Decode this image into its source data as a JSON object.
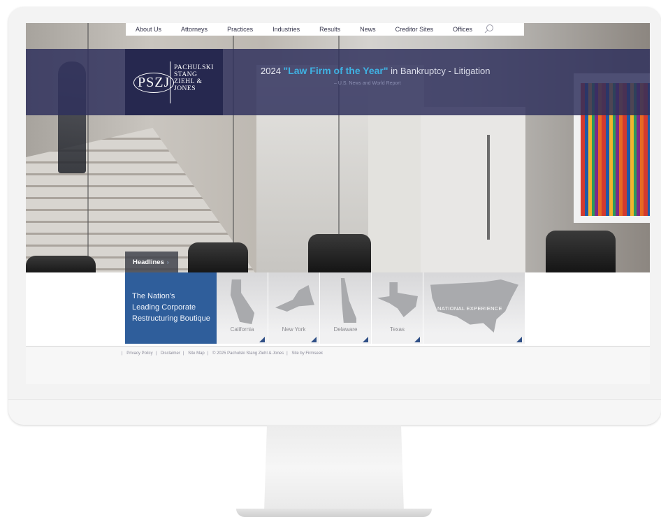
{
  "nav": {
    "items": [
      "About Us",
      "Attorneys",
      "Practices",
      "Industries",
      "Results",
      "News",
      "Creditor Sites",
      "Offices"
    ],
    "search_icon": "search-icon"
  },
  "logo": {
    "monogram": "PSZJ",
    "name_lines": [
      "PACHULSKI",
      "STANG",
      "ZIEHL &",
      "JONES"
    ]
  },
  "banner": {
    "award_year": "2024",
    "award_highlight": "\"Law Firm of the Year\"",
    "award_rest": "in Bankruptcy - Litigation",
    "award_source": "– U.S. News and World Report"
  },
  "headlines": {
    "label": "Headlines",
    "caret": "›"
  },
  "tagline": {
    "lines": [
      "The Nation's",
      "Leading Corporate",
      "Restructuring Boutique"
    ]
  },
  "tiles": {
    "california": "California",
    "new_york": "New York",
    "delaware": "Delaware",
    "texas": "Texas",
    "national": "NATIONAL EXPERIENCE"
  },
  "footer": {
    "items": [
      "Privacy Policy",
      "Disclaimer",
      "Site Map",
      "© 2025 Pachulski Stang Ziehl & Jones",
      "Site by Firmseek"
    ]
  },
  "colors": {
    "banner": "#2e305c",
    "logo_bg": "#26284f",
    "highlight": "#3fb1e2",
    "tagline_bg": "#2f5e9b"
  }
}
